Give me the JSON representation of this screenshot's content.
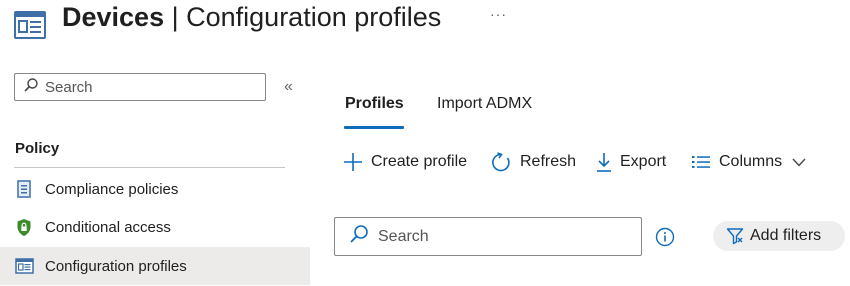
{
  "header": {
    "title_strong": "Devices",
    "title_separator": " | ",
    "title_rest": "Configuration profiles",
    "more_label": "···",
    "icon": "configuration-profile-icon"
  },
  "sidebar": {
    "search_placeholder": "Search",
    "collapse_label": "«",
    "section_title": "Policy",
    "items": [
      {
        "label": "Compliance policies",
        "icon": "compliance-policy-icon",
        "active": false
      },
      {
        "label": "Conditional access",
        "icon": "shield-lock-icon",
        "active": false
      },
      {
        "label": "Configuration profiles",
        "icon": "configuration-profile-icon",
        "active": true
      }
    ]
  },
  "tabs": [
    {
      "label": "Profiles",
      "selected": true
    },
    {
      "label": "Import ADMX",
      "selected": false
    }
  ],
  "toolbar": {
    "create_label": "Create profile",
    "refresh_label": "Refresh",
    "export_label": "Export",
    "columns_label": "Columns"
  },
  "main": {
    "search_placeholder": "Search",
    "filters_label": "Add filters"
  },
  "colors": {
    "accent": "#0f6cbd",
    "active_nav_bg": "#edebe9",
    "shield_green": "#3d8a2b"
  }
}
